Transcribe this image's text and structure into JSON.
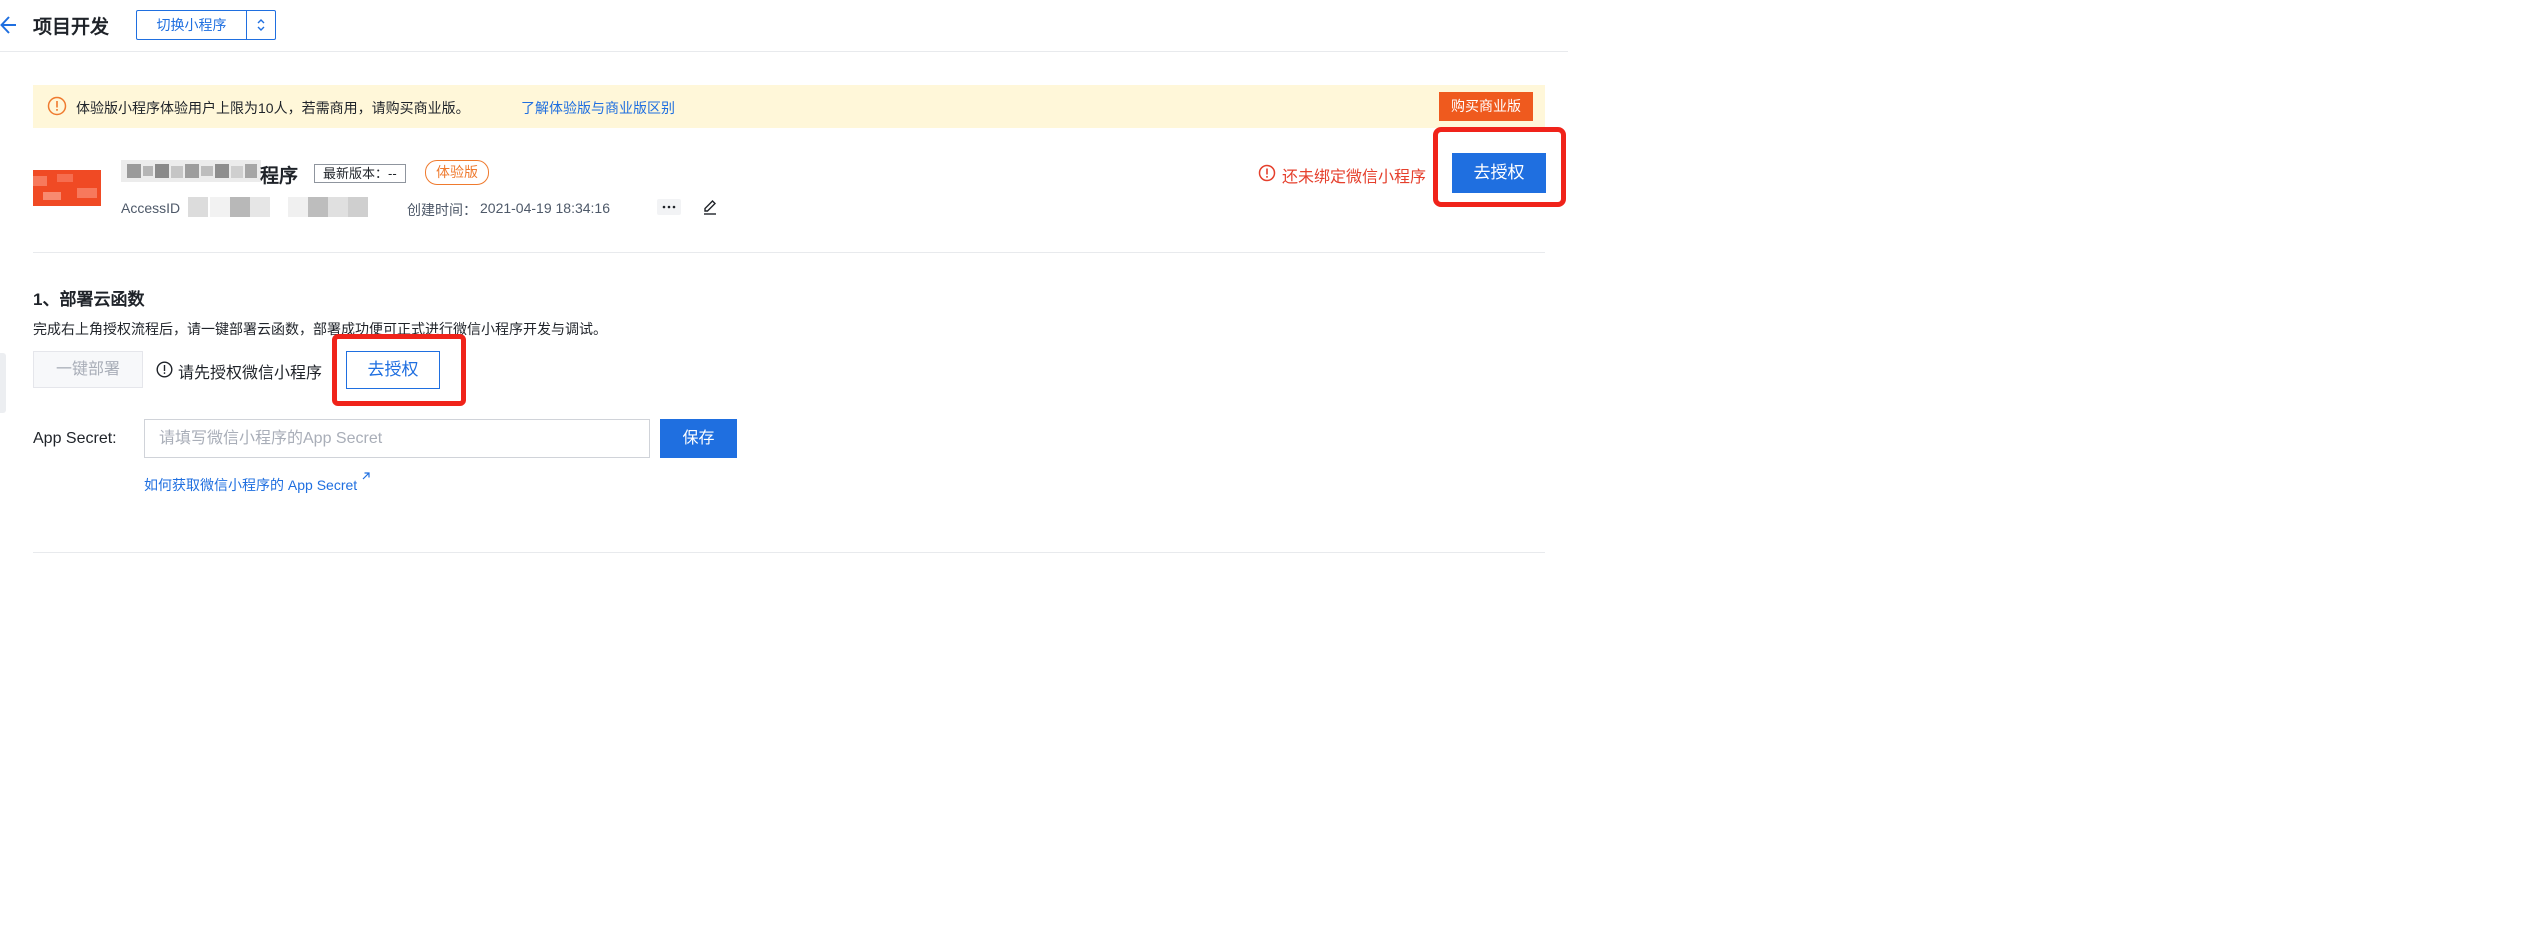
{
  "header": {
    "title": "项目开发",
    "switch_label": "切换小程序"
  },
  "notice": {
    "text": "体验版小程序体验用户上限为10人，若需商用，请购买商业版。",
    "link": "了解体验版与商业版区别",
    "buy_button": "购买商业版"
  },
  "app": {
    "name_suffix": "程序",
    "version_tag": "最新版本：--",
    "trial_tag": "体验版",
    "access_label": "AccessID",
    "create_time_label": "创建时间：",
    "create_time_value": "2021-04-19 18:34:16",
    "more_label": "···",
    "bind_warning": "还未绑定微信小程序",
    "auth_button": "去授权"
  },
  "deploy": {
    "title": "1、部署云函数",
    "description": "完成右上角授权流程后，请一键部署云函数，部署成功便可正式进行微信小程序开发与调试。",
    "deploy_button": "一键部署",
    "tip": "请先授权微信小程序",
    "auth_button": "去授权",
    "secret_label": "App Secret:",
    "secret_placeholder": "请填写微信小程序的App Secret",
    "save_button": "保存",
    "help_link": "如何获取微信小程序的 App Secret"
  },
  "colors": {
    "primary": "#1f6fe0",
    "warning": "#e53f2c",
    "notice_bg": "#fff7d9",
    "buy_button": "#ef5a1e",
    "highlight": "#f0231a"
  }
}
